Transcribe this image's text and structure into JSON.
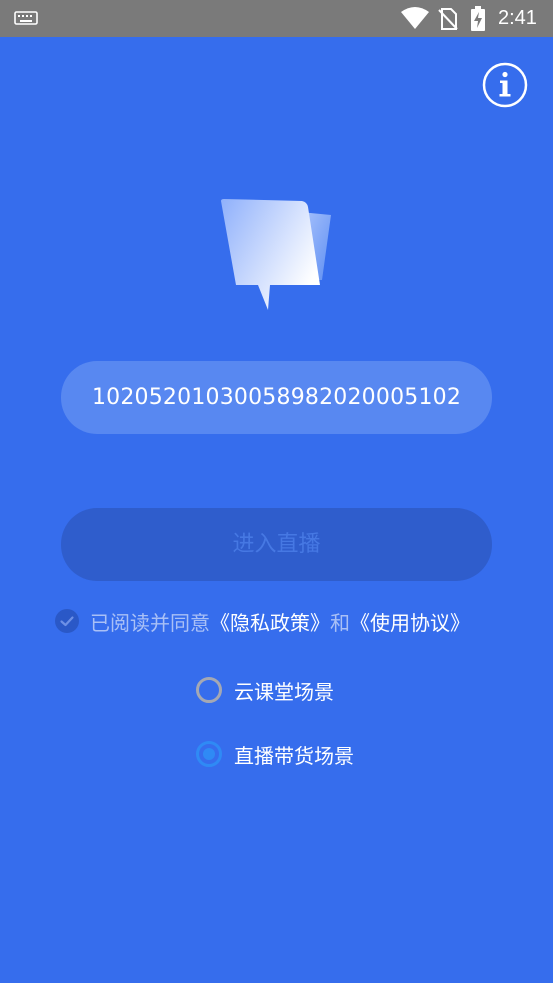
{
  "status_bar": {
    "time": "2:41",
    "icons": [
      "keyboard-icon",
      "wifi-icon",
      "no-sim-icon",
      "battery-charging-icon"
    ]
  },
  "header": {
    "info_icon": "info-icon"
  },
  "room": {
    "id_value": "10205201030058982020005102"
  },
  "actions": {
    "enter_label": "进入直播"
  },
  "agreement": {
    "prefix": "已阅读并同意",
    "privacy_link": "《隐私政策》",
    "conjunction": "和",
    "terms_link": "《使用协议》",
    "checked": true
  },
  "scenes": [
    {
      "label": "云课堂场景",
      "selected": false
    },
    {
      "label": "直播带货场景",
      "selected": true
    }
  ],
  "colors": {
    "background": "#366ded",
    "input_bg": "#5888f1",
    "button_bg": "#2f5dcc",
    "button_text": "#4678e3",
    "radio_selected": "#2f8af5",
    "status_bar": "#7a7a7a"
  }
}
